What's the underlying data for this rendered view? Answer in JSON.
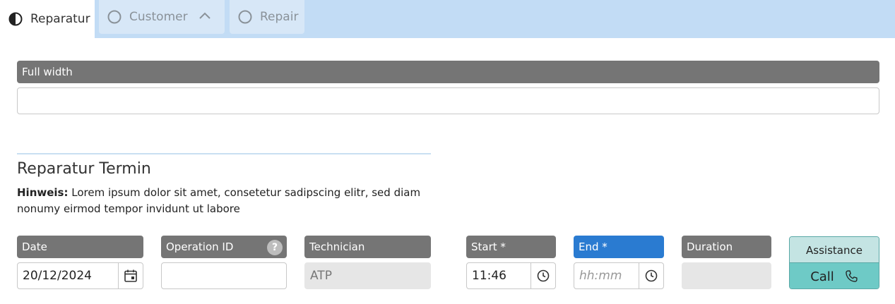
{
  "tabs": [
    {
      "label": "Reparatur",
      "state": "active",
      "icon": "half-circle-icon"
    },
    {
      "label": "Customer",
      "state": "inactive",
      "icon": "empty-circle-icon",
      "expander": "chevron-up-icon"
    },
    {
      "label": "Repair",
      "state": "inactive",
      "icon": "empty-circle-icon"
    }
  ],
  "full_width": {
    "label": "Full width",
    "value": ""
  },
  "section": {
    "title": "Reparatur Termin",
    "hint_label": "Hinweis:",
    "hint_text": "Lorem ipsum dolor sit amet, consetetur sadipscing elitr, sed diam nonumy eirmod tempor invidunt ut labore"
  },
  "fields": {
    "date": {
      "label": "Date",
      "value": "20/12/2024",
      "icon": "calendar-icon"
    },
    "operation_id": {
      "label": "Operation ID",
      "value": "",
      "help": "?"
    },
    "technician": {
      "label": "Technician",
      "value": "ATP",
      "disabled": true
    },
    "start": {
      "label": "Start *",
      "value": "11:46",
      "icon": "clock-icon"
    },
    "end": {
      "label": "End *",
      "placeholder": "hh:mm",
      "icon": "clock-icon",
      "focused": true
    },
    "duration": {
      "label": "Duration",
      "value": "",
      "disabled": true
    }
  },
  "assistance": {
    "label": "Assistance",
    "call_label": "Call",
    "icon": "phone-icon"
  },
  "colors": {
    "tabbar": "#c2dcf5",
    "header_gray": "#757575",
    "header_active": "#2a7bd1",
    "call_button": "#6ecac6",
    "assistance_bg": "#c4e4e3"
  }
}
